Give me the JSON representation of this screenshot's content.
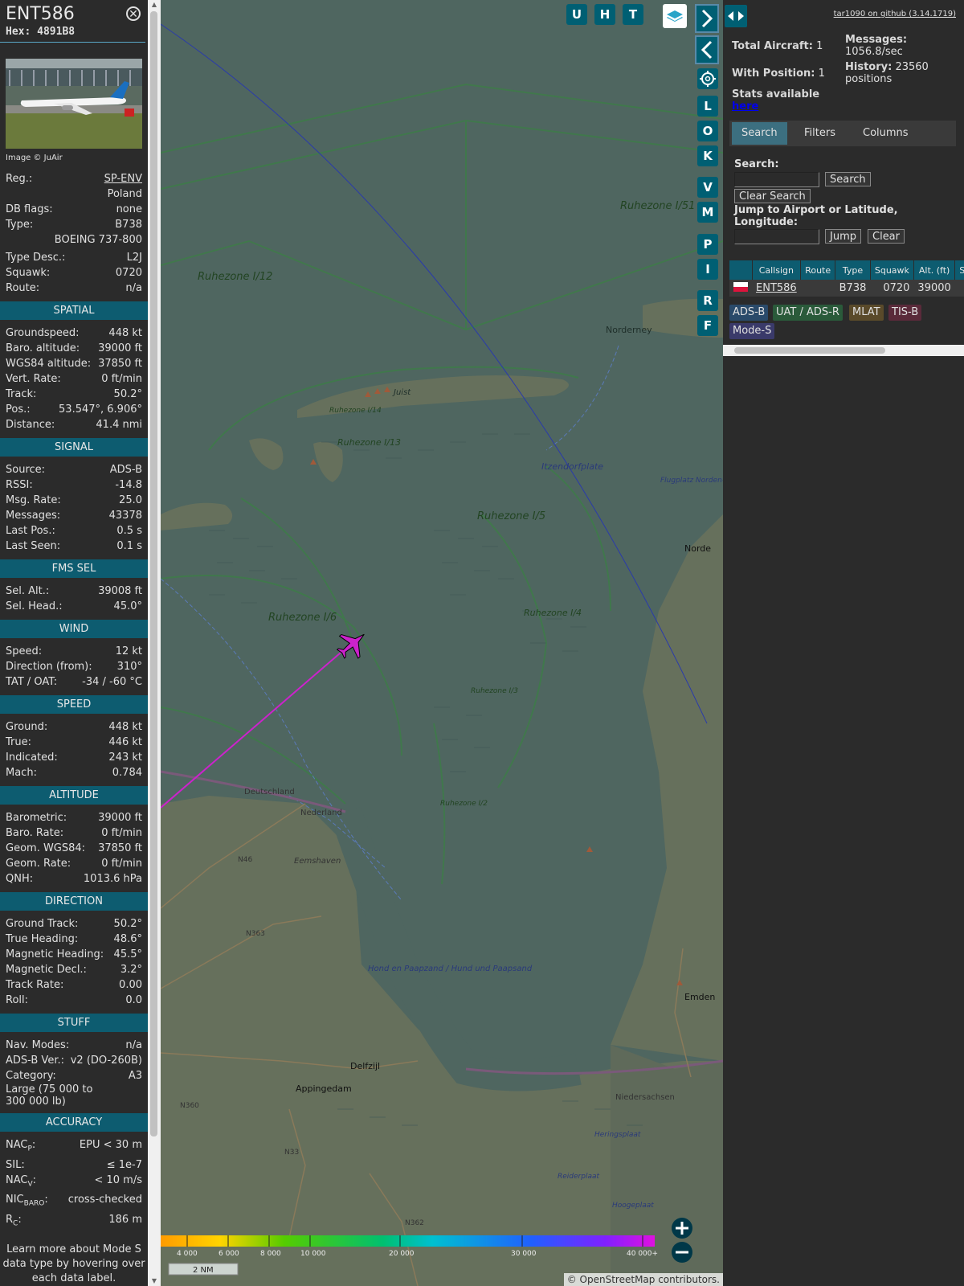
{
  "selected": {
    "callsign": "ENT586",
    "hex_label": "Hex:",
    "hex": "4891B8",
    "photo_caption": "Image © JuAir",
    "reg_label": "Reg.:",
    "reg": "SP-ENV",
    "country": "Poland",
    "dbflags_label": "DB flags:",
    "dbflags": "none",
    "type_label": "Type:",
    "type": "B738",
    "type_full": "BOEING 737-800",
    "typedesc_label": "Type Desc.:",
    "typedesc": "L2J",
    "squawk_label": "Squawk:",
    "squawk": "0720",
    "route_label": "Route:",
    "route": "n/a"
  },
  "sections": {
    "spatial": {
      "title": "SPATIAL",
      "rows": [
        {
          "label": "Groundspeed:",
          "value": "448 kt"
        },
        {
          "label": "Baro. altitude:",
          "value": "39000 ft"
        },
        {
          "label": "WGS84 altitude:",
          "value": "37850 ft"
        },
        {
          "label": "Vert. Rate:",
          "value": "0 ft/min"
        },
        {
          "label": "Track:",
          "value": "50.2°"
        },
        {
          "label": "Pos.:",
          "value": "53.547°, 6.906°"
        },
        {
          "label": "Distance:",
          "value": "41.4 nmi"
        }
      ]
    },
    "signal": {
      "title": "SIGNAL",
      "rows": [
        {
          "label": "Source:",
          "value": "ADS-B"
        },
        {
          "label": "RSSI:",
          "value": "-14.8"
        },
        {
          "label": "Msg. Rate:",
          "value": "25.0"
        },
        {
          "label": "Messages:",
          "value": "43378"
        },
        {
          "label": "Last Pos.:",
          "value": "0.5 s"
        },
        {
          "label": "Last Seen:",
          "value": "0.1 s"
        }
      ]
    },
    "fms": {
      "title": "FMS SEL",
      "rows": [
        {
          "label": "Sel. Alt.:",
          "value": "39008 ft"
        },
        {
          "label": "Sel. Head.:",
          "value": "45.0°"
        }
      ]
    },
    "wind": {
      "title": "WIND",
      "rows": [
        {
          "label": "Speed:",
          "value": "12 kt"
        },
        {
          "label": "Direction (from):",
          "value": "310°"
        },
        {
          "label": "TAT / OAT:",
          "value": "-34 / -60 °C"
        }
      ]
    },
    "speed": {
      "title": "SPEED",
      "rows": [
        {
          "label": "Ground:",
          "value": "448 kt"
        },
        {
          "label": "True:",
          "value": "446 kt"
        },
        {
          "label": "Indicated:",
          "value": "243 kt"
        },
        {
          "label": "Mach:",
          "value": "0.784"
        }
      ]
    },
    "altitude": {
      "title": "ALTITUDE",
      "rows": [
        {
          "label": "Barometric:",
          "value": "39000 ft"
        },
        {
          "label": "Baro. Rate:",
          "value": "0 ft/min"
        },
        {
          "label": "Geom. WGS84:",
          "value": "37850 ft"
        },
        {
          "label": "Geom. Rate:",
          "value": "0 ft/min"
        },
        {
          "label": "QNH:",
          "value": "1013.6 hPa"
        }
      ]
    },
    "direction": {
      "title": "DIRECTION",
      "rows": [
        {
          "label": "Ground Track:",
          "value": "50.2°"
        },
        {
          "label": "True Heading:",
          "value": "48.6°"
        },
        {
          "label": "Magnetic Heading:",
          "value": "45.5°"
        },
        {
          "label": "Magnetic Decl.:",
          "value": "3.2°"
        },
        {
          "label": "Track Rate:",
          "value": "0.00"
        },
        {
          "label": "Roll:",
          "value": "0.0"
        }
      ]
    },
    "stuff": {
      "title": "STUFF",
      "rows": [
        {
          "label": "Nav. Modes:",
          "value": "n/a"
        },
        {
          "label": "ADS-B Ver.:",
          "value": "v2 (DO-260B)"
        },
        {
          "label": "Category:",
          "value": "A3"
        }
      ],
      "category_desc": "Large (75 000 to 300 000 lb)"
    },
    "accuracy": {
      "title": "ACCURACY",
      "rows": [
        {
          "label": "NACP:",
          "value": "EPU < 30 m"
        },
        {
          "label": "SIL:",
          "value": "≤ 1e-7"
        },
        {
          "label": "NACV:",
          "value": "< 10 m/s"
        },
        {
          "label": "NICBARO:",
          "value": "cross-checked"
        },
        {
          "label": "RC:",
          "value": "186 m"
        }
      ]
    },
    "learn_more": "Learn more about Mode S data type by hovering over each data label."
  },
  "map": {
    "buttons_top": [
      "U",
      "H",
      "T"
    ],
    "buttons_side": [
      "L",
      "O",
      "K",
      "V",
      "M",
      "P",
      "I",
      "R",
      "F"
    ],
    "labels": [
      {
        "text": "Ruhezone I/51"
      },
      {
        "text": "Ruhezone I/12"
      },
      {
        "text": "Norderney"
      },
      {
        "text": "Juist"
      },
      {
        "text": "Ruhezone I/14"
      },
      {
        "text": "Ruhezone I/13"
      },
      {
        "text": "Itzendorfplate"
      },
      {
        "text": "Ruhezone I/5"
      },
      {
        "text": "Ruhezone I/6"
      },
      {
        "text": "Ruhezone I/4"
      },
      {
        "text": "Ruhezone I/3"
      },
      {
        "text": "Ruhezone I/2"
      },
      {
        "text": "Deutschland"
      },
      {
        "text": "Nederland"
      },
      {
        "text": "Eemshaven"
      },
      {
        "text": "Delfzijl"
      },
      {
        "text": "Appingedam"
      },
      {
        "text": "Emden"
      },
      {
        "text": "Niedersachsen"
      },
      {
        "text": "Heringsplaat"
      },
      {
        "text": "Hond en Paapzand / Hund und Paapsand"
      },
      {
        "text": "N46"
      },
      {
        "text": "N363"
      },
      {
        "text": "N360"
      },
      {
        "text": "N33"
      },
      {
        "text": "N362"
      },
      {
        "text": "Flugplatz Norden-Norddeich"
      },
      {
        "text": "Norde"
      },
      {
        "text": "Reiderplaat"
      },
      {
        "text": "Hoogeplaat"
      }
    ],
    "alt_scale": [
      "4 000",
      "6 000",
      "8 000",
      "10 000",
      "20 000",
      "30 000",
      "40 000+"
    ],
    "scale_bar": "2 NM",
    "attribution": "© OpenStreetMap contributors."
  },
  "right": {
    "github_link": "tar1090 on github (3.14.1719)",
    "total_label": "Total Aircraft:",
    "total": "1",
    "withpos_label": "With Position:",
    "withpos": "1",
    "stats_label": "Stats available",
    "stats_link": "here",
    "messages_label": "Messages:",
    "messages": "1056.8/sec",
    "history_label": "History:",
    "history": "23560 positions",
    "tabs": [
      "Search",
      "Filters",
      "Columns"
    ],
    "search_label": "Search:",
    "search_btn": "Search",
    "clear_search_btn": "Clear Search",
    "jump_label": "Jump to Airport or Latitude, Longitude:",
    "jump_btn": "Jump",
    "clear_btn": "Clear",
    "table": {
      "headers": [
        "",
        "Callsign",
        "Route",
        "Type",
        "Squawk",
        "Alt. (ft)",
        "Spd."
      ],
      "row": {
        "callsign": "ENT586",
        "route": "",
        "type": "B738",
        "squawk": "0720",
        "alt": "39000"
      }
    },
    "legend": [
      "ADS-B",
      "UAT / ADS-R",
      "MLAT",
      "TIS-B",
      "Mode-S"
    ]
  }
}
